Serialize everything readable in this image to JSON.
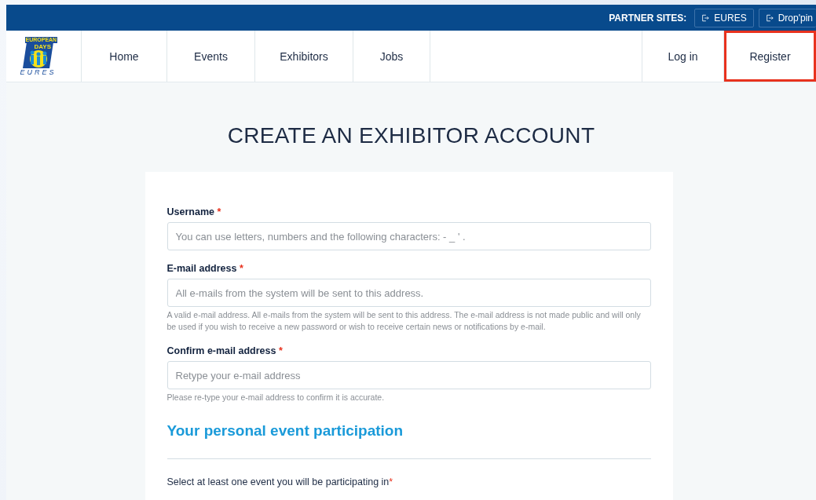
{
  "partner_bar": {
    "label": "PARTNER SITES:",
    "links": [
      "EURES",
      "Drop'pin"
    ]
  },
  "logo": {
    "top": "EUROPEAN",
    "middle": "DAYS",
    "bottom": "EURES"
  },
  "nav": {
    "left": [
      {
        "label": "Home",
        "highlighted": false
      },
      {
        "label": "Events",
        "highlighted": false
      },
      {
        "label": "Exhibitors",
        "highlighted": false
      },
      {
        "label": "Jobs",
        "highlighted": false
      }
    ],
    "right": [
      {
        "label": "Log in",
        "highlighted": false
      },
      {
        "label": "Register",
        "highlighted": true
      }
    ]
  },
  "page_title": "CREATE AN EXHIBITOR ACCOUNT",
  "form": {
    "fields": [
      {
        "label": "Username",
        "required": true,
        "required_mark": "*",
        "placeholder": "You can use letters, numbers and the following characters: - _ ' ."
      },
      {
        "label": "E-mail address",
        "required": true,
        "required_mark": "*",
        "placeholder": "All e-mails from the system will be sent to this address.",
        "help": "A valid e-mail address. All e-mails from the system will be sent to this address. The e-mail address is not made public and will only be used if you wish to receive a new password or wish to receive certain news or notifications by e-mail."
      },
      {
        "label": "Confirm e-mail address",
        "required": true,
        "required_mark": "*",
        "placeholder": "Retype your e-mail address",
        "help": "Please re-type your e-mail address to confirm it is accurate."
      }
    ],
    "section_title": "Your personal event participation",
    "event_prompt": "Select at least one event you will be participating in",
    "event_prompt_required": true,
    "event_required_mark": "*"
  }
}
